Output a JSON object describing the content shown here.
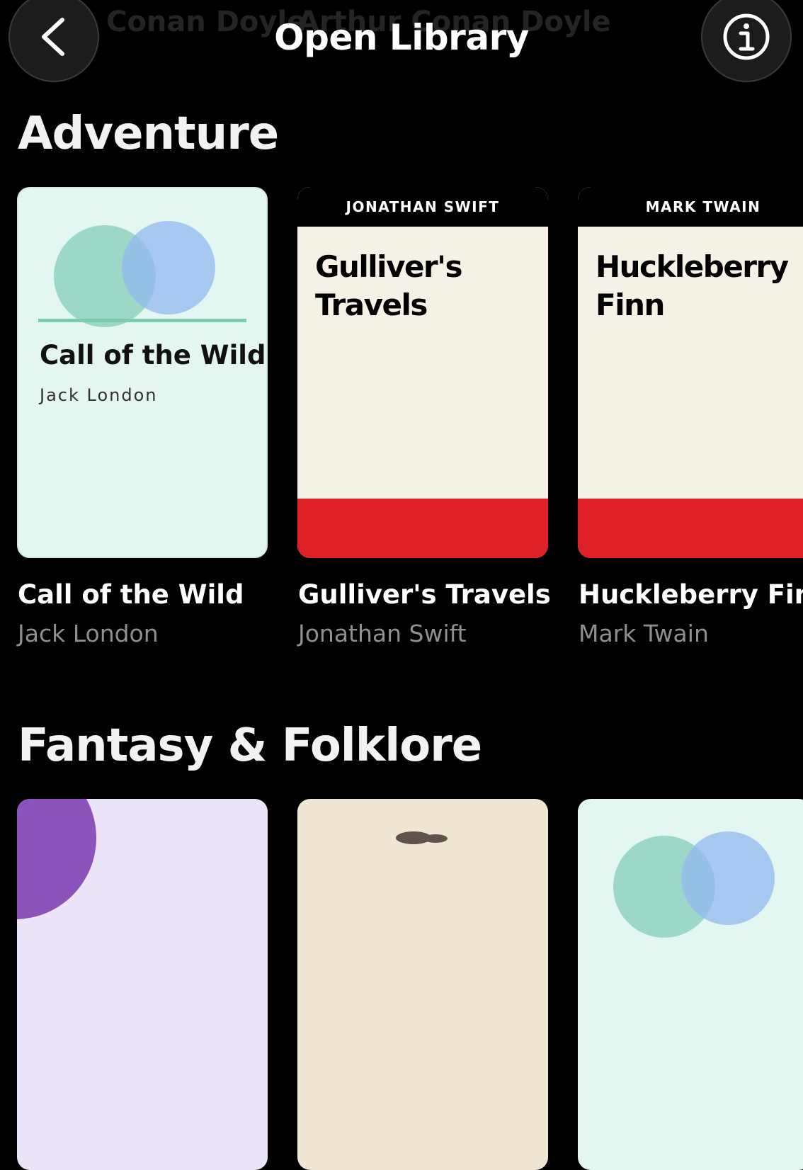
{
  "header": {
    "title": "Open Library",
    "ghost_left": "Conan Doyle",
    "ghost_right": "Arthur Conan Doyle",
    "back_icon": "chevron-left-icon",
    "info_icon": "info-circle-icon"
  },
  "sections": [
    {
      "title": "Adventure",
      "books": [
        {
          "title": "Call of the Wild",
          "author": "Jack London",
          "cover_title": "Call of the Wild",
          "cover_author": "Jack  London",
          "cover_style": "circles-mint"
        },
        {
          "title": "Gulliver's Travels",
          "author": "Jonathan Swift",
          "cover_author": "JONATHAN SWIFT",
          "cover_title": "Gulliver's Travels",
          "cover_style": "classic-red-band"
        },
        {
          "title": "Huckleberry Finn",
          "author": "Mark Twain",
          "cover_author": "MARK TWAIN",
          "cover_title": "Huckleberry Finn",
          "cover_style": "classic-red-band"
        }
      ]
    },
    {
      "title": "Fantasy & Folklore",
      "books": [
        {
          "cover_style": "purple-lavender"
        },
        {
          "cover_style": "beige-stones"
        },
        {
          "cover_style": "circles-mint"
        }
      ]
    }
  ],
  "colors": {
    "background": "#000000",
    "accent_red": "#df2026",
    "secondary_text": "#8e8e93",
    "mint": "#e3f6f1",
    "cream": "#f5f1e6"
  }
}
